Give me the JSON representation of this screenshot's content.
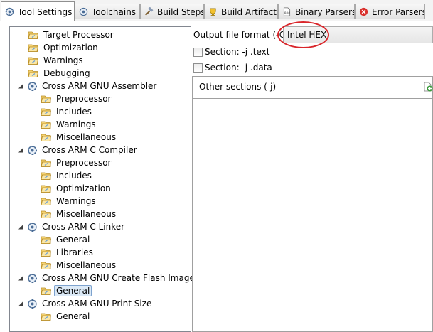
{
  "tabs": [
    {
      "label": "Tool Settings",
      "icon": "gear-icon",
      "active": true
    },
    {
      "label": "Toolchains",
      "icon": "gear-icon"
    },
    {
      "label": "Build Steps",
      "icon": "hammer-icon"
    },
    {
      "label": "Build Artifact",
      "icon": "artifact-icon"
    },
    {
      "label": "Binary Parsers",
      "icon": "binary-file-icon"
    },
    {
      "label": "Error Parsers",
      "icon": "error-icon"
    }
  ],
  "tree": {
    "items": [
      {
        "label": "Target Processor",
        "kind": "folder"
      },
      {
        "label": "Optimization",
        "kind": "folder"
      },
      {
        "label": "Warnings",
        "kind": "folder"
      },
      {
        "label": "Debugging",
        "kind": "folder"
      },
      {
        "label": "Cross ARM GNU Assembler",
        "kind": "tool"
      },
      {
        "label": "Preprocessor",
        "kind": "child"
      },
      {
        "label": "Includes",
        "kind": "child"
      },
      {
        "label": "Warnings",
        "kind": "child"
      },
      {
        "label": "Miscellaneous",
        "kind": "child"
      },
      {
        "label": "Cross ARM C Compiler",
        "kind": "tool"
      },
      {
        "label": "Preprocessor",
        "kind": "child"
      },
      {
        "label": "Includes",
        "kind": "child"
      },
      {
        "label": "Optimization",
        "kind": "child"
      },
      {
        "label": "Warnings",
        "kind": "child"
      },
      {
        "label": "Miscellaneous",
        "kind": "child"
      },
      {
        "label": "Cross ARM C Linker",
        "kind": "tool"
      },
      {
        "label": "General",
        "kind": "child"
      },
      {
        "label": "Libraries",
        "kind": "child"
      },
      {
        "label": "Miscellaneous",
        "kind": "child"
      },
      {
        "label": "Cross ARM GNU Create Flash Image",
        "kind": "tool"
      },
      {
        "label": "General",
        "kind": "child",
        "selected": true
      },
      {
        "label": "Cross ARM GNU Print Size",
        "kind": "tool"
      },
      {
        "label": "General",
        "kind": "child"
      }
    ]
  },
  "settings": {
    "output_format_label": "Output file format (-O)",
    "output_format_value": "Intel HEX",
    "section_text_label": "Section: -j .text",
    "section_data_label": "Section: -j .data",
    "other_sections_label": "Other sections (-j)"
  },
  "colors": {
    "highlight_circle": "#d9252a",
    "selection_fill": "#dceaf7",
    "selection_border": "#7da2ce"
  }
}
